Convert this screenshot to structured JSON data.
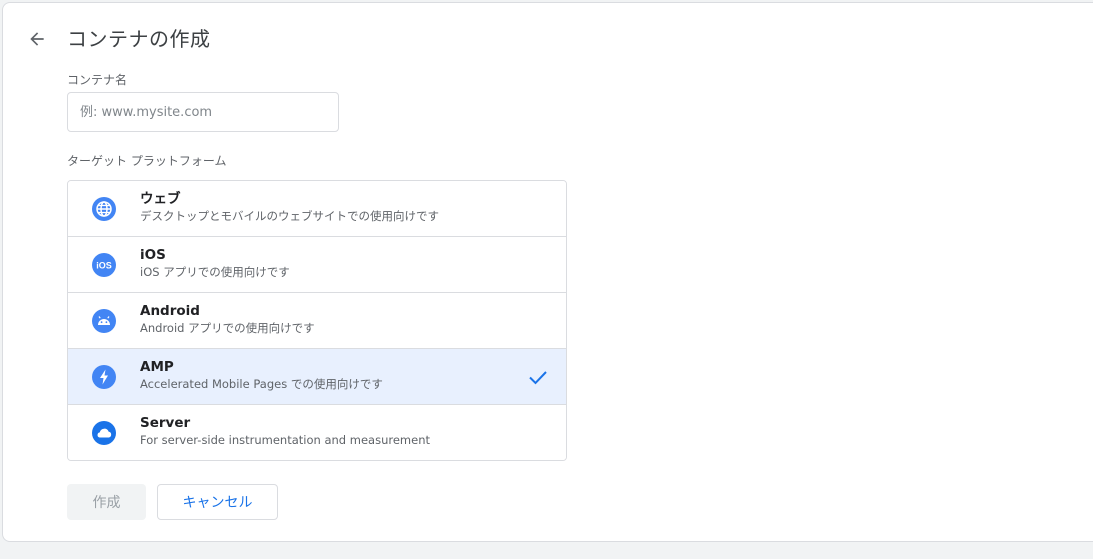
{
  "page": {
    "title": "コンテナの作成"
  },
  "form": {
    "name_label": "コンテナ名",
    "name_placeholder": "例: www.mysite.com",
    "name_value": "",
    "platform_label": "ターゲット プラットフォーム"
  },
  "platforms": [
    {
      "title": "ウェブ",
      "desc": "デスクトップとモバイルのウェブサイトでの使用向けです",
      "icon": "globe-icon",
      "selected": false
    },
    {
      "title": "iOS",
      "desc": "iOS アプリでの使用向けです",
      "icon": "ios-icon",
      "selected": false
    },
    {
      "title": "Android",
      "desc": "Android アプリでの使用向けです",
      "icon": "android-icon",
      "selected": false
    },
    {
      "title": "AMP",
      "desc": "Accelerated Mobile Pages での使用向けです",
      "icon": "amp-bolt-icon",
      "selected": true
    },
    {
      "title": "Server",
      "desc": "For server-side instrumentation and measurement",
      "icon": "cloud-icon",
      "selected": false
    }
  ],
  "actions": {
    "create_label": "作成",
    "cancel_label": "キャンセル"
  },
  "colors": {
    "accent": "#1a73e8",
    "icon_blue": "#4285f4",
    "selected_bg": "#e8f0fe"
  }
}
